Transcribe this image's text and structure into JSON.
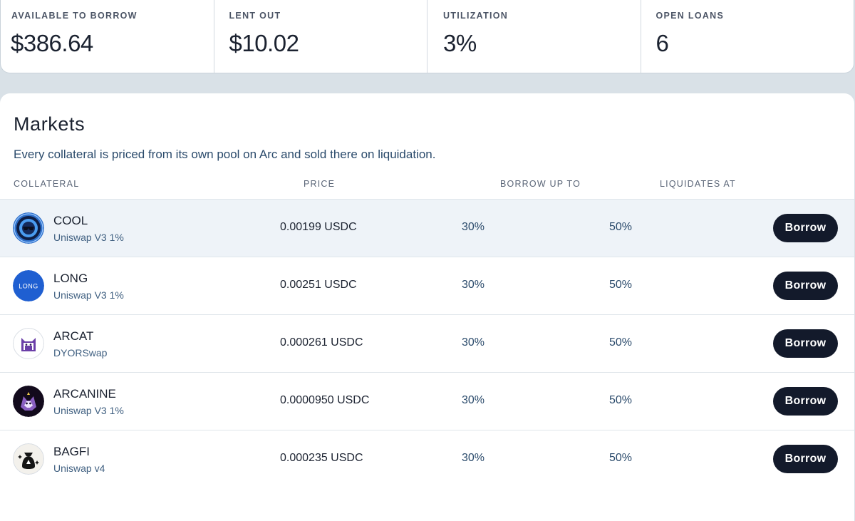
{
  "stats": [
    {
      "label": "AVAILABLE TO BORROW",
      "value": "$386.64"
    },
    {
      "label": "LENT OUT",
      "value": "$10.02"
    },
    {
      "label": "UTILIZATION",
      "value": "3%"
    },
    {
      "label": "OPEN LOANS",
      "value": "6"
    }
  ],
  "markets": {
    "title": "Markets",
    "subtitle": "Every collateral is priced from its own pool on Arc and sold there on liquidation.",
    "columns": {
      "collateral": "COLLATERAL",
      "price": "PRICE",
      "borrow_up_to": "BORROW UP TO",
      "liquidates_at": "LIQUIDATES AT"
    },
    "rows": [
      {
        "name": "COOL",
        "pool": "Uniswap V3 1%",
        "price": "0.00199 USDC",
        "borrow_up_to": "30%",
        "liquidates_at": "50%",
        "action": "Borrow",
        "icon": "cool-token-icon"
      },
      {
        "name": "LONG",
        "pool": "Uniswap V3 1%",
        "price": "0.00251 USDC",
        "borrow_up_to": "30%",
        "liquidates_at": "50%",
        "action": "Borrow",
        "icon": "long-token-icon",
        "icon_text": "LONG"
      },
      {
        "name": "ARCAT",
        "pool": "DYORSwap",
        "price": "0.000261 USDC",
        "borrow_up_to": "30%",
        "liquidates_at": "50%",
        "action": "Borrow",
        "icon": "arcat-token-icon"
      },
      {
        "name": "ARCANINE",
        "pool": "Uniswap V3 1%",
        "price": "0.0000950 USDC",
        "borrow_up_to": "30%",
        "liquidates_at": "50%",
        "action": "Borrow",
        "icon": "arcanine-token-icon"
      },
      {
        "name": "BAGFI",
        "pool": "Uniswap v4",
        "price": "0.000235 USDC",
        "borrow_up_to": "30%",
        "liquidates_at": "50%",
        "action": "Borrow",
        "icon": "bagfi-token-icon"
      }
    ]
  }
}
